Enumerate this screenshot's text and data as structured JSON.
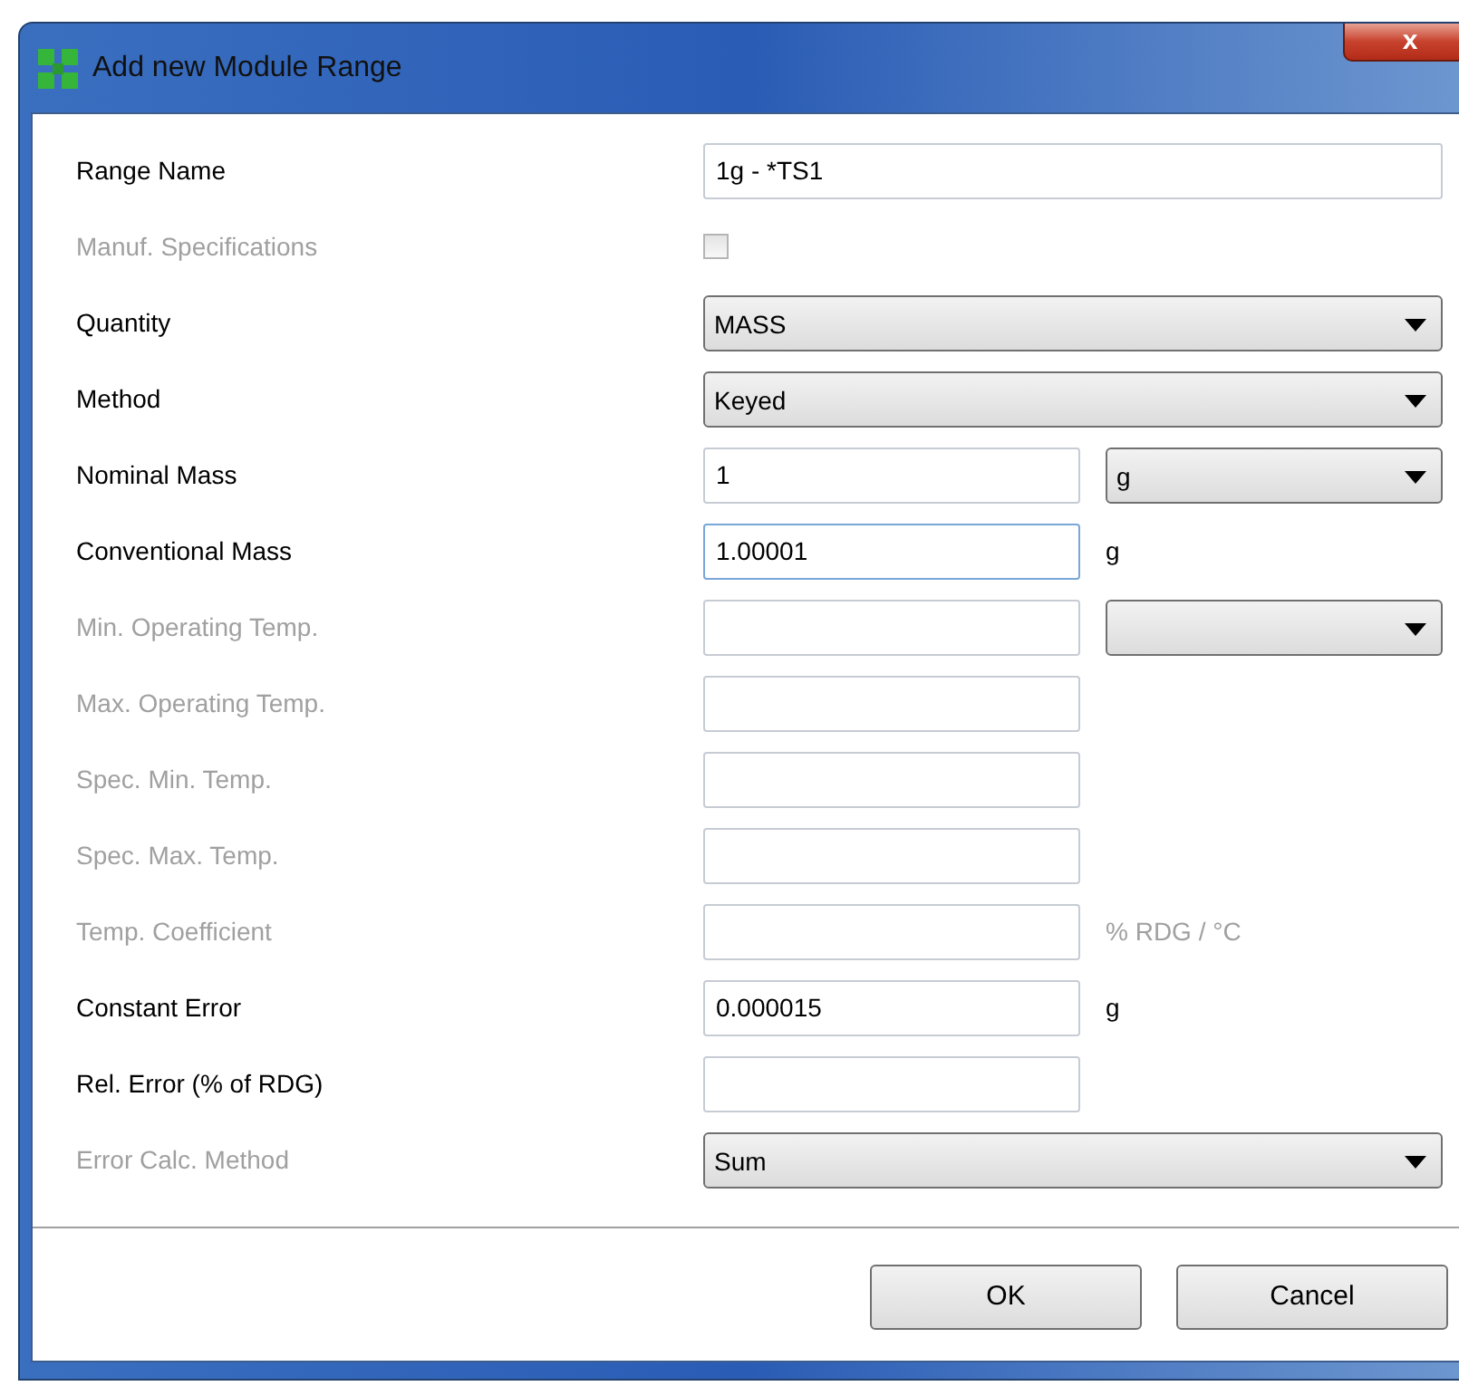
{
  "window": {
    "title": "Add new Module Range",
    "close": "x"
  },
  "fields": [
    {
      "label": "Range Name",
      "disabled": false,
      "kind": "text-wide",
      "value": "1g - *TS1",
      "focused": false
    },
    {
      "label": "Manuf. Specifications",
      "disabled": true,
      "kind": "checkbox",
      "checked": false
    },
    {
      "label": "Quantity",
      "disabled": false,
      "kind": "select-wide",
      "value": "MASS"
    },
    {
      "label": "Method",
      "disabled": false,
      "kind": "select-wide",
      "value": "Keyed"
    },
    {
      "label": "Nominal Mass",
      "disabled": false,
      "kind": "text",
      "value": "1",
      "focused": false,
      "unit": {
        "kind": "select",
        "value": "g"
      }
    },
    {
      "label": "Conventional Mass",
      "disabled": false,
      "kind": "text",
      "value": "1.00001",
      "focused": true,
      "unit": {
        "kind": "text",
        "text": "g"
      }
    },
    {
      "label": "Min. Operating Temp.",
      "disabled": true,
      "kind": "text",
      "focused": false,
      "unit": {
        "kind": "select"
      }
    },
    {
      "label": "Max. Operating Temp.",
      "disabled": true,
      "kind": "text",
      "focused": false
    },
    {
      "label": "Spec. Min. Temp.",
      "disabled": true,
      "kind": "text",
      "focused": false
    },
    {
      "label": "Spec. Max. Temp.",
      "disabled": true,
      "kind": "text",
      "focused": false
    },
    {
      "label": "Temp. Coefficient",
      "disabled": true,
      "kind": "text",
      "focused": false,
      "unit": {
        "kind": "text",
        "text": "% RDG / °C",
        "disabled": true
      }
    },
    {
      "label": "Constant Error",
      "disabled": false,
      "kind": "text",
      "value": "0.000015",
      "focused": false,
      "unit": {
        "kind": "text",
        "text": "g",
        "disabled": false
      }
    },
    {
      "label": "Rel. Error (% of RDG)",
      "disabled": false,
      "kind": "text",
      "focused": false
    },
    {
      "label": "Error Calc. Method",
      "disabled": true,
      "kind": "select-wide",
      "value": "Sum"
    }
  ],
  "buttons": [
    "OK",
    "Cancel"
  ]
}
